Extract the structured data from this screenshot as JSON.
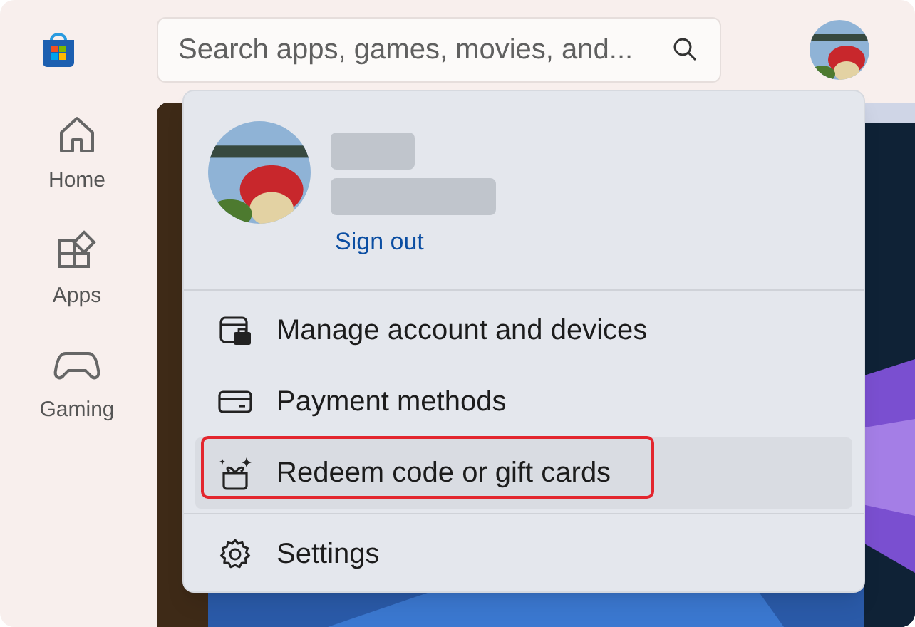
{
  "search": {
    "placeholder": "Search apps, games, movies, and..."
  },
  "sidebar": {
    "items": [
      {
        "label": "Home",
        "kind": "home"
      },
      {
        "label": "Apps",
        "kind": "apps"
      },
      {
        "label": "Gaming",
        "kind": "gaming"
      }
    ]
  },
  "account_menu": {
    "sign_out": "Sign out",
    "items": [
      {
        "label": "Manage account and devices",
        "kind": "manage",
        "hovered": false,
        "outlined": false
      },
      {
        "label": "Payment methods",
        "kind": "payment",
        "hovered": false,
        "outlined": false
      },
      {
        "label": "Redeem code or gift cards",
        "kind": "redeem",
        "hovered": true,
        "outlined": true
      },
      {
        "label": "Settings",
        "kind": "settings",
        "hovered": false,
        "outlined": false
      }
    ]
  }
}
